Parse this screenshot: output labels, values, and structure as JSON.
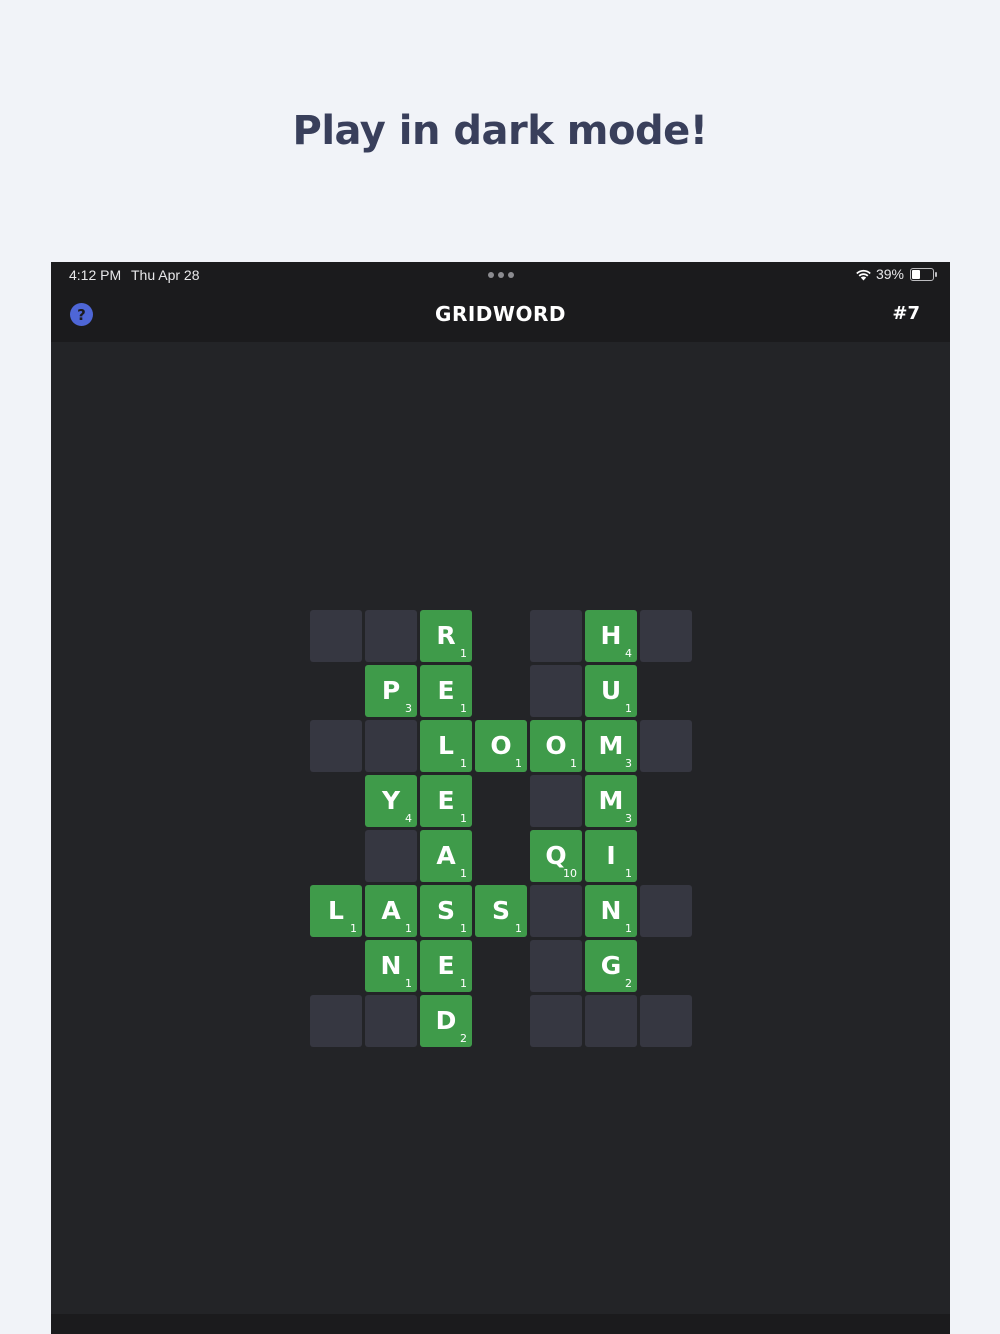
{
  "headline": "Play in dark mode!",
  "status_bar": {
    "time": "4:12 PM",
    "date": "Thu Apr 28",
    "battery_percent": "39%",
    "battery_level": 0.39
  },
  "header": {
    "help_label": "?",
    "title": "GRIDWORD",
    "puzzle_number": "#7"
  },
  "colors": {
    "tile_green": "#3f9b4a",
    "empty_cell": "#363741",
    "help_blue": "#4e66d6"
  },
  "grid": {
    "rows": [
      [
        null,
        {
          "letter": "",
          "score": ""
        },
        {
          "letter": "",
          "score": ""
        },
        {
          "letter": "R",
          "score": "1"
        },
        null,
        {
          "letter": "",
          "score": ""
        },
        {
          "letter": "H",
          "score": "4"
        },
        {
          "letter": "",
          "score": ""
        }
      ],
      [
        null,
        null,
        {
          "letter": "P",
          "score": "3"
        },
        {
          "letter": "E",
          "score": "1"
        },
        null,
        {
          "letter": "",
          "score": ""
        },
        {
          "letter": "U",
          "score": "1"
        },
        null
      ],
      [
        null,
        {
          "letter": "",
          "score": ""
        },
        {
          "letter": "",
          "score": ""
        },
        {
          "letter": "L",
          "score": "1"
        },
        {
          "letter": "O",
          "score": "1"
        },
        {
          "letter": "O",
          "score": "1"
        },
        {
          "letter": "M",
          "score": "3"
        },
        {
          "letter": "",
          "score": ""
        }
      ],
      [
        null,
        null,
        {
          "letter": "Y",
          "score": "4"
        },
        {
          "letter": "E",
          "score": "1"
        },
        null,
        {
          "letter": "",
          "score": ""
        },
        {
          "letter": "M",
          "score": "3"
        },
        null
      ],
      [
        null,
        null,
        {
          "letter": "",
          "score": ""
        },
        {
          "letter": "A",
          "score": "1"
        },
        null,
        {
          "letter": "Q",
          "score": "10"
        },
        {
          "letter": "I",
          "score": "1"
        },
        null
      ],
      [
        null,
        {
          "letter": "L",
          "score": "1"
        },
        {
          "letter": "A",
          "score": "1"
        },
        {
          "letter": "S",
          "score": "1"
        },
        {
          "letter": "S",
          "score": "1"
        },
        {
          "letter": "",
          "score": ""
        },
        {
          "letter": "N",
          "score": "1"
        },
        {
          "letter": "",
          "score": ""
        }
      ],
      [
        null,
        null,
        {
          "letter": "N",
          "score": "1"
        },
        {
          "letter": "E",
          "score": "1"
        },
        null,
        {
          "letter": "",
          "score": ""
        },
        {
          "letter": "G",
          "score": "2"
        },
        null
      ],
      [
        null,
        {
          "letter": "",
          "score": ""
        },
        {
          "letter": "",
          "score": ""
        },
        {
          "letter": "D",
          "score": "2"
        },
        null,
        {
          "letter": "",
          "score": ""
        },
        {
          "letter": "",
          "score": ""
        },
        {
          "letter": "",
          "score": ""
        }
      ]
    ]
  }
}
